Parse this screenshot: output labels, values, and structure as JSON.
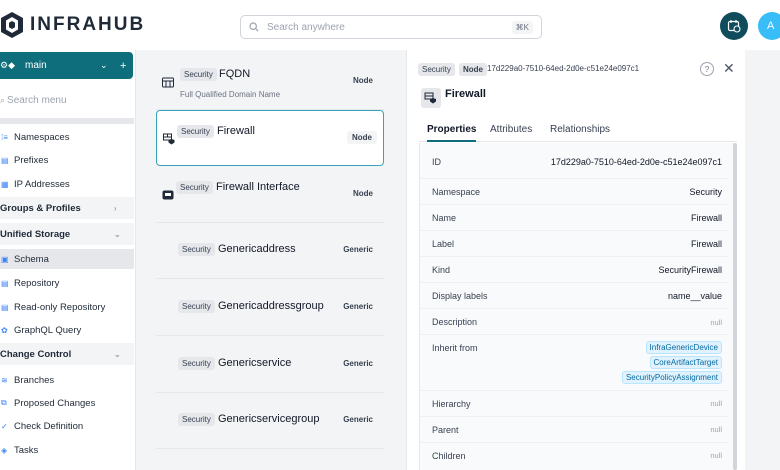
{
  "app": {
    "name": "INFRAHUB"
  },
  "search": {
    "placeholder": "Search anywhere",
    "shortcut": "⌘K"
  },
  "user": {
    "avatar_initial": "A"
  },
  "sidebar": {
    "branch": {
      "name": "main"
    },
    "search_placeholder": "Search menu",
    "items": [
      {
        "label": "Namespaces"
      },
      {
        "label": "Prefixes"
      },
      {
        "label": "IP Addresses"
      },
      {
        "label": "Groups & Profiles",
        "group": true
      },
      {
        "label": "Unified Storage",
        "group": true
      },
      {
        "label": "Schema",
        "active": true
      },
      {
        "label": "Repository"
      },
      {
        "label": "Read-only Repository"
      },
      {
        "label": "GraphQL Query"
      },
      {
        "label": "Change Control",
        "group": true
      },
      {
        "label": "Branches"
      },
      {
        "label": "Proposed Changes"
      },
      {
        "label": "Check Definition"
      },
      {
        "label": "Tasks"
      }
    ]
  },
  "list": {
    "items": [
      {
        "namespace": "Security",
        "name": "FQDN",
        "description": "Full Qualified Domain Name",
        "kind": "Node",
        "icon": "globe-icon"
      },
      {
        "namespace": "Security",
        "name": "Firewall",
        "description": "",
        "kind": "Node",
        "icon": "firewall-icon",
        "selected": true
      },
      {
        "namespace": "Security",
        "name": "Firewall Interface",
        "description": "",
        "kind": "Node",
        "icon": "interface-icon"
      },
      {
        "namespace": "Security",
        "name": "Genericaddress",
        "description": "",
        "kind": "Generic"
      },
      {
        "namespace": "Security",
        "name": "Genericaddressgroup",
        "description": "",
        "kind": "Generic"
      },
      {
        "namespace": "Security",
        "name": "Genericservice",
        "description": "",
        "kind": "Generic"
      },
      {
        "namespace": "Security",
        "name": "Genericservicegroup",
        "description": "",
        "kind": "Generic"
      }
    ]
  },
  "detail": {
    "namespace_badge": "Security",
    "kind_badge": "Node",
    "id": "17d229a0-7510-64ed-2d0e-c51e24e097c1",
    "help_label": "?",
    "close_label": "✕",
    "title": "Firewall",
    "tabs": [
      "Properties",
      "Attributes",
      "Relationships"
    ],
    "properties": [
      {
        "label": "ID",
        "value": "17d229a0-7510-64ed-2d0e-c51e24e097c1"
      },
      {
        "label": "Namespace",
        "value": "Security"
      },
      {
        "label": "Name",
        "value": "Firewall"
      },
      {
        "label": "Label",
        "value": "Firewall"
      },
      {
        "label": "Kind",
        "value": "SecurityFirewall"
      },
      {
        "label": "Display labels",
        "value": "name__value"
      },
      {
        "label": "Description",
        "value": "null"
      },
      {
        "label": "Inherit from",
        "values": [
          "InfraGenericDevice",
          "CoreArtifactTarget",
          "SecurityPolicyAssignment"
        ]
      },
      {
        "label": "Hierarchy",
        "value": "null"
      },
      {
        "label": "Parent",
        "value": "null"
      },
      {
        "label": "Children",
        "value": "null"
      }
    ]
  },
  "colors": {
    "brand": "#0f6e7c",
    "brand_dark": "#0f4c5c",
    "avatar": "#38bdf8",
    "link": "#0369a1"
  }
}
